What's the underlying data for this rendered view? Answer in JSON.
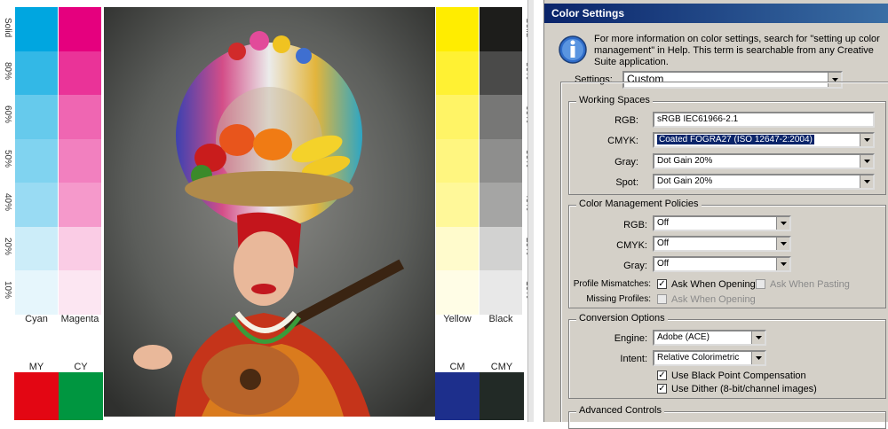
{
  "chart": {
    "left_columns": [
      {
        "name": "Cyan",
        "color": "#00a6e0"
      },
      {
        "name": "Magenta",
        "color": "#e5007e"
      }
    ],
    "right_columns": [
      {
        "name": "Yellow",
        "color": "#ffed00"
      },
      {
        "name": "Black",
        "color": "#1d1d1b"
      }
    ],
    "tint_steps": [
      "Solid",
      "80%",
      "60%",
      "50%",
      "40%",
      "20%",
      "10%"
    ],
    "tint_levels": [
      1.0,
      0.8,
      0.6,
      0.5,
      0.4,
      0.2,
      0.1
    ],
    "overprints_left": [
      {
        "name": "MY",
        "color": "#e30613"
      },
      {
        "name": "CY",
        "color": "#009640"
      }
    ],
    "overprints_right": [
      {
        "name": "CM",
        "color": "#1d2f8c"
      },
      {
        "name": "CMY",
        "color": "#222a26"
      }
    ]
  },
  "dialog": {
    "title": "Color Settings",
    "info": "For more information on color settings, search for \"setting up color management\" in Help. This term is searchable from any Creative Suite application.",
    "settings_label": "Settings:",
    "settings_value": "Custom",
    "working_spaces": {
      "title": "Working Spaces",
      "rgb_label": "RGB:",
      "rgb_value": "sRGB IEC61966-2.1",
      "cmyk_label": "CMYK:",
      "cmyk_value": "Coated FOGRA27 (ISO 12647-2:2004)",
      "gray_label": "Gray:",
      "gray_value": "Dot Gain 20%",
      "spot_label": "Spot:",
      "spot_value": "Dot Gain 20%"
    },
    "policies": {
      "title": "Color Management Policies",
      "rgb_label": "RGB:",
      "rgb_value": "Off",
      "cmyk_label": "CMYK:",
      "cmyk_value": "Off",
      "gray_label": "Gray:",
      "gray_value": "Off",
      "mismatch_label": "Profile Mismatches:",
      "ask_opening": "Ask When Opening",
      "ask_pasting": "Ask When Pasting",
      "missing_label": "Missing Profiles:",
      "missing_ask_opening": "Ask When Opening"
    },
    "conversion": {
      "title": "Conversion Options",
      "engine_label": "Engine:",
      "engine_value": "Adobe (ACE)",
      "intent_label": "Intent:",
      "intent_value": "Relative Colorimetric",
      "black_point": "Use Black Point Compensation",
      "dither": "Use Dither (8-bit/channel images)"
    },
    "advanced": {
      "title": "Advanced Controls"
    }
  }
}
